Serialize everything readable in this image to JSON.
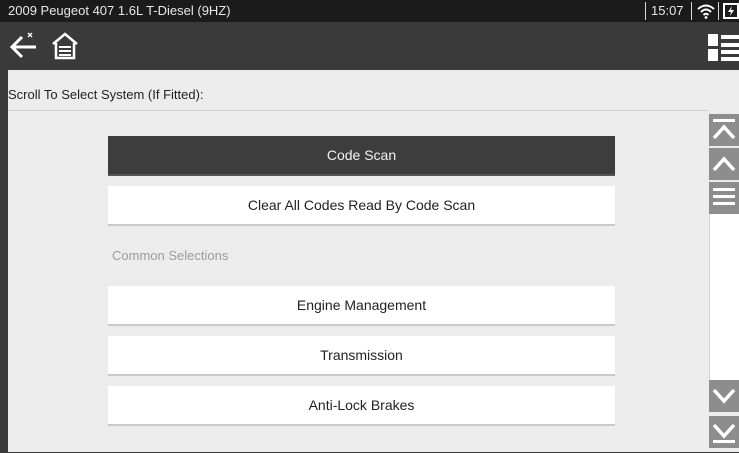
{
  "status_bar": {
    "vehicle_title": "2009 Peugeot 407 1.6L T-Diesel (9HZ)",
    "time": "15:07",
    "icons": [
      "wifi-icon",
      "battery-charging-icon"
    ]
  },
  "toolbar": {
    "back_icon": "back-arrow-icon",
    "home_icon": "home-icon",
    "view_icon": "list-view-icon"
  },
  "main": {
    "instruction": "Scroll To Select System (If Fitted):",
    "items": [
      {
        "label": "Code Scan",
        "selected": true
      },
      {
        "label": "Clear All Codes Read By Code Scan",
        "selected": false
      }
    ],
    "section_label": "Common Selections",
    "common_items": [
      {
        "label": "Engine Management"
      },
      {
        "label": "Transmission"
      },
      {
        "label": "Anti-Lock Brakes"
      }
    ]
  },
  "scrollbar": {
    "icons": [
      "scroll-top-icon",
      "scroll-up-icon",
      "scroll-down-icon",
      "scroll-bottom-icon"
    ]
  },
  "colors": {
    "header_bg": "#3a3a3a",
    "status_bg": "#1b1b1b",
    "selected_bg": "#3d3d3d",
    "content_bg": "#ececec",
    "scroll_button": "#8d8d8d"
  }
}
